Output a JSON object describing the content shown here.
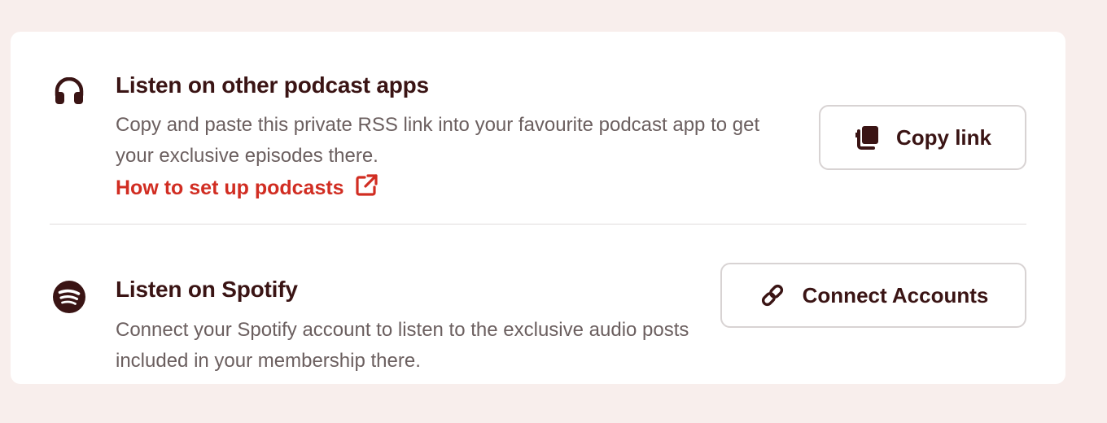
{
  "rss": {
    "icon": "headphones-icon",
    "title": "Listen on other podcast apps",
    "description": "Copy and paste this private RSS link into your favourite podcast app to get your exclusive episodes there.",
    "help_link": "How to set up podcasts",
    "help_link_icon": "external-link-icon",
    "button_label": "Copy link",
    "button_icon": "copy-icon"
  },
  "spotify": {
    "icon": "spotify-icon",
    "title": "Listen on Spotify",
    "description": "Connect your Spotify account to listen to the exclusive audio posts included in your membership there.",
    "button_label": "Connect Accounts",
    "button_icon": "link-icon"
  },
  "colors": {
    "page_background": "#f8eeec",
    "card_background": "#ffffff",
    "text_dark": "#3a1414",
    "text_muted": "#6b5f5f",
    "link_accent": "#d12d22",
    "button_border": "#d8d3d3"
  }
}
